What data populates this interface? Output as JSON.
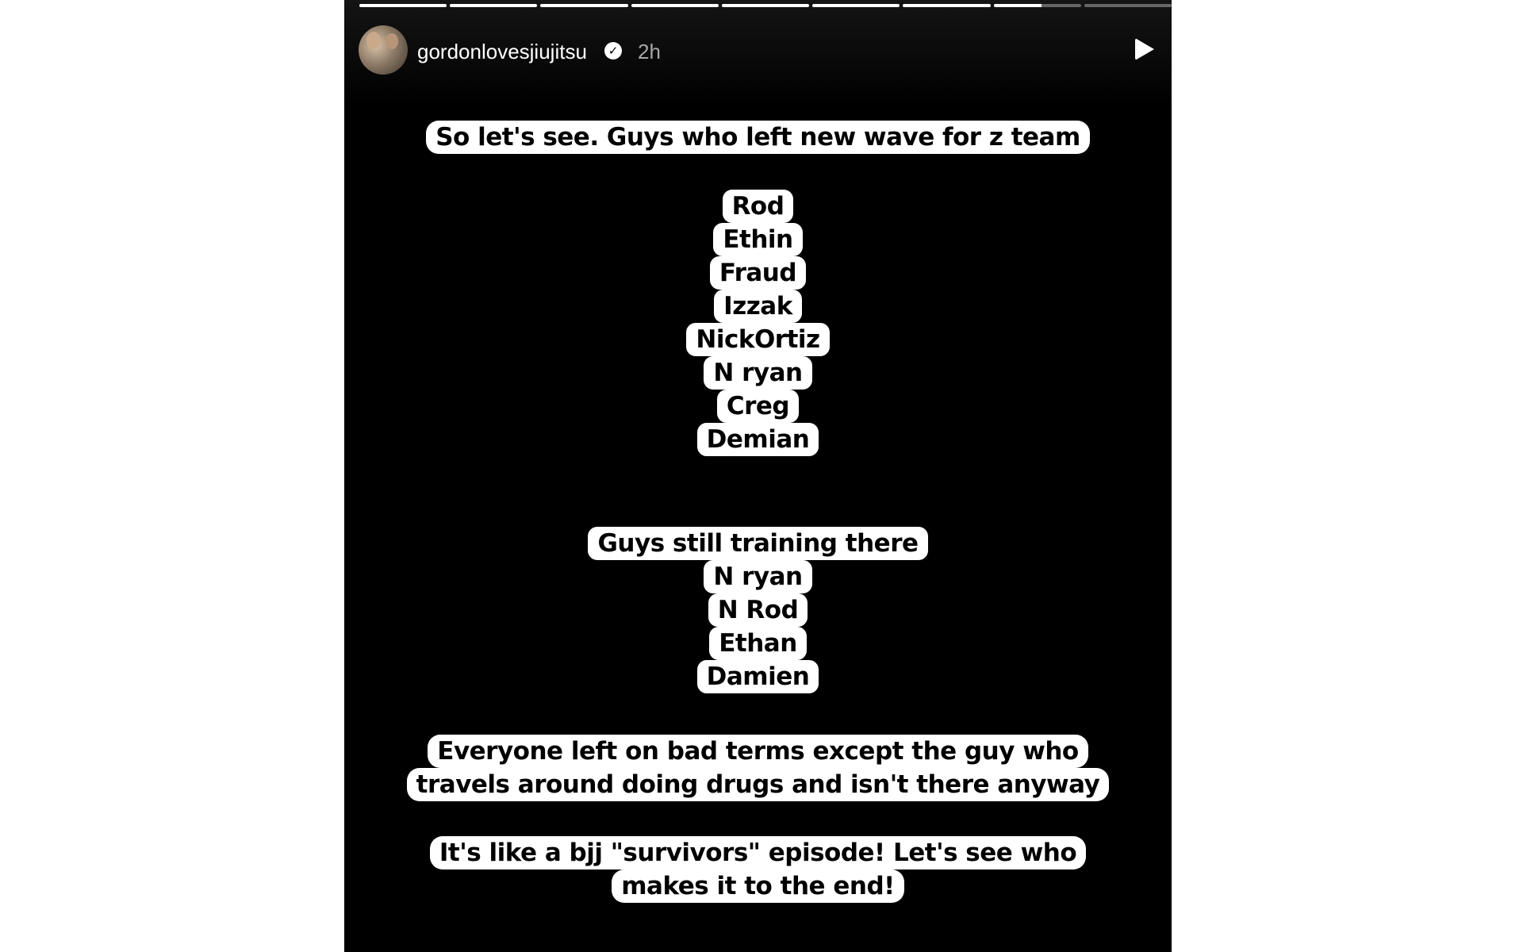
{
  "story": {
    "progress": [
      1,
      1,
      1,
      1,
      1,
      1,
      1,
      0.55,
      0
    ],
    "header": {
      "username": "gordonlovesjiujitsu",
      "verified_icon": "verified-check-icon",
      "time": "2h",
      "play_icon": "play-icon"
    },
    "texts": {
      "headline": "So let's see. Guys who left  new wave for z team",
      "left_list": [
        "Rod",
        "Ethin",
        "Fraud",
        "Izzak",
        "NickOrtiz",
        "N ryan",
        "Creg",
        "Demian"
      ],
      "still_heading": "Guys still training there",
      "still_list": [
        "N ryan",
        "N Rod",
        "Ethan",
        "Damien"
      ],
      "everyone": [
        "Everyone left on bad terms except the guy who",
        "travels around doing drugs  and isn't there anyway"
      ],
      "survivors": [
        "It's like a bjj \"survivors\" episode! Let's see who",
        "makes it to the end!"
      ]
    }
  }
}
